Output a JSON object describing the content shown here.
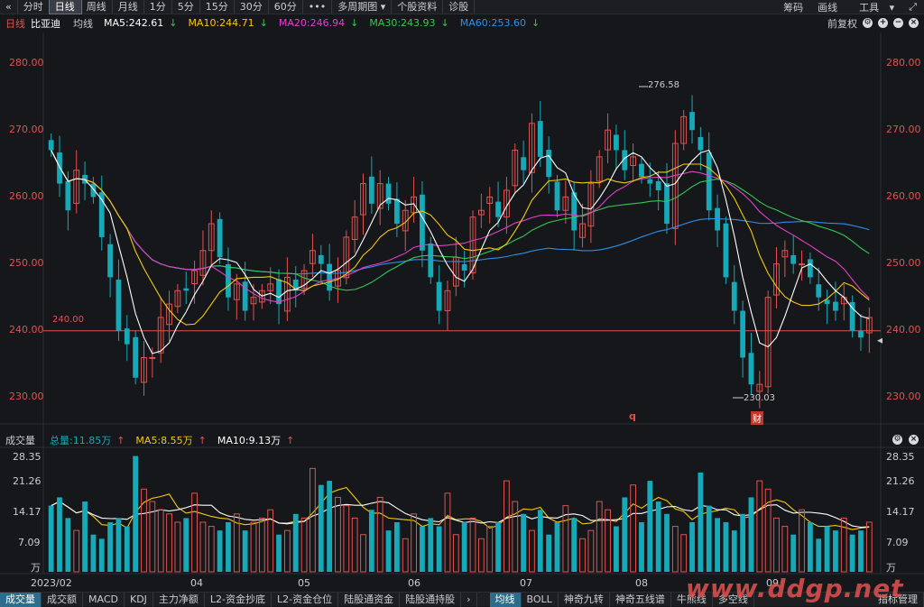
{
  "toolbar": {
    "back_icon": "double-chevron-left-icon",
    "tabs": [
      "分时",
      "日线",
      "周线",
      "月线",
      "1分",
      "5分",
      "15分",
      "30分",
      "60分",
      "•••"
    ],
    "active_tab": "日线",
    "multi_period": "多周期图",
    "stock_info": "个股资料",
    "diagnose": "诊股",
    "right": [
      "筹码",
      "画线",
      "工具"
    ]
  },
  "info": {
    "period": "日线",
    "name": "比亚迪",
    "ma_label": "均线",
    "ma5": "MA5:242.61",
    "ma10": "MA10:244.71",
    "ma20": "MA20:246.94",
    "ma30": "MA30:243.93",
    "ma60": "MA60:253.60",
    "adjust": "前复权",
    "colors": {
      "ma5": "#ffffff",
      "ma10": "#f2c80f",
      "ma20": "#e040c8",
      "ma30": "#32c850",
      "ma60": "#2f8ee8",
      "up": "#e0524f",
      "down": "#16a9b8"
    }
  },
  "price_axis": [
    "280.00",
    "270.00",
    "260.00",
    "250.00",
    "240.00",
    "230.00"
  ],
  "annotations": {
    "high": "276.58",
    "low": "230.03",
    "hline": "240.00",
    "q_mark": "q",
    "cai_mark": "财"
  },
  "volume": {
    "label": "成交量",
    "total": "总量:11.85万",
    "ma5": "MA5:8.55万",
    "ma10": "MA10:9.13万",
    "axis": [
      "28.35",
      "21.26",
      "14.17",
      "7.09",
      "万"
    ]
  },
  "x_axis": [
    "2023/02",
    "04",
    "05",
    "06",
    "07",
    "08",
    "09"
  ],
  "bottom_tabs": [
    "成交量",
    "成交额",
    "MACD",
    "KDJ",
    "主力净额",
    "L2-资金抄底",
    "L2-资金仓位",
    "陆股通资金",
    "陆股通持股"
  ],
  "bottom_right_tabs": [
    "均线",
    "BOLL",
    "神奇九转",
    "神奇五线谱",
    "牛熊线",
    "多空线"
  ],
  "bottom_last": "指标管理",
  "watermark": "www.ddgp.net",
  "chart_data": {
    "type": "candlestick",
    "ylim": [
      227,
      283
    ],
    "close": [
      267,
      262,
      258,
      264,
      262,
      260,
      254,
      248,
      240,
      238,
      233,
      236,
      236,
      242,
      244,
      246,
      246,
      249,
      252,
      256,
      251,
      245,
      247,
      243,
      245,
      246,
      247,
      244,
      248,
      246,
      249,
      252,
      250,
      246,
      249,
      254,
      257,
      262,
      259,
      262,
      259,
      256,
      258,
      260,
      252,
      248,
      243,
      246,
      251,
      249,
      257,
      258,
      260,
      257,
      261,
      267,
      264,
      271,
      266,
      263,
      258,
      260,
      255,
      256,
      262,
      266,
      270,
      267,
      264,
      266,
      263,
      262,
      261,
      256,
      268,
      272,
      270,
      267,
      258,
      255,
      248,
      243,
      236,
      232,
      232,
      245,
      250,
      252,
      250,
      250,
      248,
      245,
      244,
      243,
      245,
      240,
      239,
      242
    ],
    "volume": [
      16,
      18,
      13,
      10,
      17,
      9,
      8,
      12,
      13,
      11,
      28,
      20,
      17,
      15,
      14,
      12,
      13,
      19,
      12,
      11,
      10,
      12,
      14,
      10,
      12,
      13,
      15,
      9,
      10,
      14,
      13,
      25,
      21,
      22,
      18,
      16,
      13,
      9,
      15,
      18,
      10,
      12,
      8,
      14,
      11,
      13,
      11,
      19,
      9,
      12,
      13,
      8,
      11,
      12,
      22,
      17,
      14,
      10,
      15,
      9,
      12,
      16,
      13,
      8,
      10,
      17,
      15,
      11,
      18,
      21,
      12,
      22,
      17,
      14,
      11,
      9,
      12,
      24,
      16,
      13,
      12,
      10,
      14,
      18,
      22,
      20,
      13,
      11,
      9,
      15,
      12,
      8,
      11,
      10,
      13,
      9,
      10,
      12
    ]
  }
}
